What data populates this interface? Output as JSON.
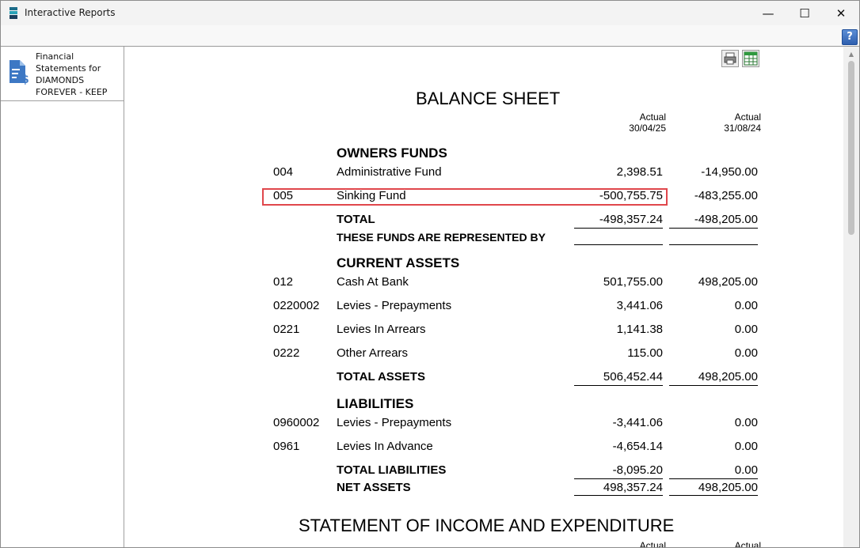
{
  "window": {
    "title": "Interactive Reports"
  },
  "window_controls": {
    "minimize": "—",
    "maximize": "☐",
    "close": "✕"
  },
  "toolbar": {
    "help": "?"
  },
  "nav": {
    "items": [
      {
        "label": "Financial Statements for DIAMONDS FOREVER - KEEP"
      }
    ]
  },
  "report": {
    "title": "BALANCE SHEET",
    "columns": [
      {
        "label": "Actual",
        "date": "30/04/25"
      },
      {
        "label": "Actual",
        "date": "31/08/24"
      }
    ],
    "owners_funds": {
      "heading": "OWNERS FUNDS",
      "rows": [
        {
          "code": "004",
          "name": "Administrative Fund",
          "current": "2,398.51",
          "prior": "-14,950.00"
        },
        {
          "code": "005",
          "name": "Sinking Fund",
          "current": "-500,755.75",
          "prior": "-483,255.00"
        }
      ],
      "total": {
        "name": "TOTAL",
        "current": "-498,357.24",
        "prior": "-498,205.00"
      },
      "represented_by": "THESE FUNDS ARE REPRESENTED BY"
    },
    "current_assets": {
      "heading": "CURRENT ASSETS",
      "rows": [
        {
          "code": "012",
          "name": "Cash At Bank",
          "current": "501,755.00",
          "prior": "498,205.00"
        },
        {
          "code": "0220002",
          "name": "Levies - Prepayments",
          "current": "3,441.06",
          "prior": "0.00"
        },
        {
          "code": "0221",
          "name": "Levies In Arrears",
          "current": "1,141.38",
          "prior": "0.00"
        },
        {
          "code": "0222",
          "name": "Other Arrears",
          "current": "115.00",
          "prior": "0.00"
        }
      ],
      "total": {
        "name": "TOTAL ASSETS",
        "current": "506,452.44",
        "prior": "498,205.00"
      }
    },
    "liabilities": {
      "heading": "LIABILITIES",
      "rows": [
        {
          "code": "0960002",
          "name": "Levies - Prepayments",
          "current": "-3,441.06",
          "prior": "0.00"
        },
        {
          "code": "0961",
          "name": "Levies In Advance",
          "current": "-4,654.14",
          "prior": "0.00"
        }
      ],
      "total": {
        "name": "TOTAL LIABILITIES",
        "current": "-8,095.20",
        "prior": "0.00"
      }
    },
    "net_assets": {
      "name": "NET ASSETS",
      "current": "498,357.24",
      "prior": "498,205.00"
    },
    "next_title": "STATEMENT OF INCOME AND EXPENDITURE",
    "next_columns": [
      {
        "label": "Actual"
      },
      {
        "label": "Actual"
      }
    ]
  },
  "colors": {
    "highlight": "#e0474c",
    "accent": "#2e5fae"
  }
}
